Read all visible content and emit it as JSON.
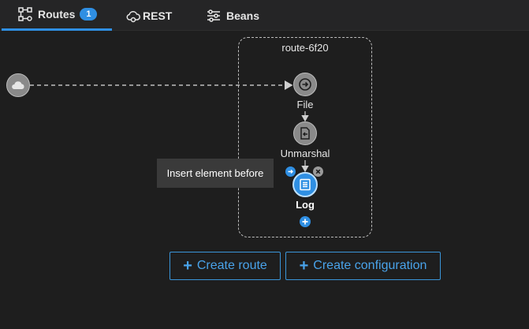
{
  "tabs": [
    {
      "label": "Routes",
      "badge": "1",
      "icon": "routes-icon",
      "active": true
    },
    {
      "label": "REST",
      "icon": "cloud-gear-icon",
      "active": false
    },
    {
      "label": "Beans",
      "icon": "sliders-icon",
      "active": false
    }
  ],
  "route": {
    "title": "route-6f20",
    "source_icon": "cloud-icon",
    "steps": [
      {
        "label": "File",
        "icon": "file-arrow-icon"
      },
      {
        "label": "Unmarshal",
        "icon": "unmarshal-icon"
      },
      {
        "label": "Log",
        "icon": "log-icon",
        "selected": true
      }
    ]
  },
  "tooltip": "Insert element before",
  "actions": {
    "create_route": "Create route",
    "create_configuration": "Create configuration"
  },
  "colors": {
    "accent": "#2f8fe3",
    "background": "#1e1e1e",
    "tabbar": "#252526"
  }
}
